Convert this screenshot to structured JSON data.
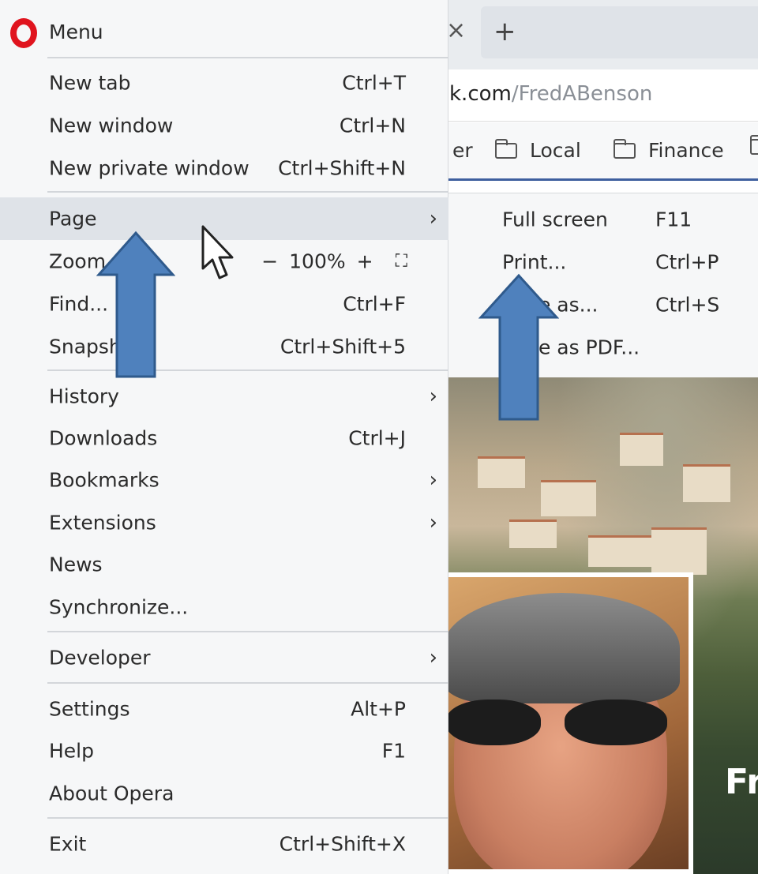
{
  "menu": {
    "title": "Menu",
    "items": [
      {
        "label": "New tab",
        "shortcut": "Ctrl+T"
      },
      {
        "label": "New window",
        "shortcut": "Ctrl+N"
      },
      {
        "label": "New private window",
        "shortcut": "Ctrl+Shift+N"
      },
      {
        "label": "Page",
        "shortcut": ""
      },
      {
        "label": "Zoom",
        "shortcut": ""
      },
      {
        "label": "Find...",
        "shortcut": "Ctrl+F"
      },
      {
        "label": "Snapshot",
        "shortcut": "Ctrl+Shift+5"
      },
      {
        "label": "History",
        "shortcut": ""
      },
      {
        "label": "Downloads",
        "shortcut": "Ctrl+J"
      },
      {
        "label": "Bookmarks",
        "shortcut": ""
      },
      {
        "label": "Extensions",
        "shortcut": ""
      },
      {
        "label": "News",
        "shortcut": ""
      },
      {
        "label": "Synchronize...",
        "shortcut": ""
      },
      {
        "label": "Developer",
        "shortcut": ""
      },
      {
        "label": "Settings",
        "shortcut": "Alt+P"
      },
      {
        "label": "Help",
        "shortcut": "F1"
      },
      {
        "label": "About Opera",
        "shortcut": ""
      },
      {
        "label": "Exit",
        "shortcut": "Ctrl+Shift+X"
      }
    ],
    "zoom": {
      "minus": "−",
      "value": "100%",
      "plus": "+",
      "fullscreen": "⛶"
    },
    "chevron": "›"
  },
  "page_submenu": {
    "items": [
      {
        "label": "Full screen",
        "shortcut": "F11"
      },
      {
        "label": "Print...",
        "shortcut": "Ctrl+P"
      },
      {
        "label": "Save as...",
        "shortcut": "Ctrl+S"
      },
      {
        "label": "Save as PDF...",
        "shortcut": ""
      }
    ]
  },
  "browser": {
    "tab_close": "×",
    "new_tab": "+",
    "url_host": "k.com",
    "url_path": "/FredABenson",
    "bookmarks": [
      "er",
      "Local",
      "Finance"
    ],
    "profile_name_partial": "Fr"
  },
  "colors": {
    "menu_bg": "#f6f7f8",
    "hover_bg": "#dfe3e8",
    "opera_red": "#e0141e",
    "arrow_blue": "#4f81bd",
    "arrow_outline": "#2f5a8c"
  },
  "icons": {
    "logo": "opera-logo-icon",
    "cursor": "mouse-pointer-icon",
    "annotation": "up-arrow-icon"
  }
}
